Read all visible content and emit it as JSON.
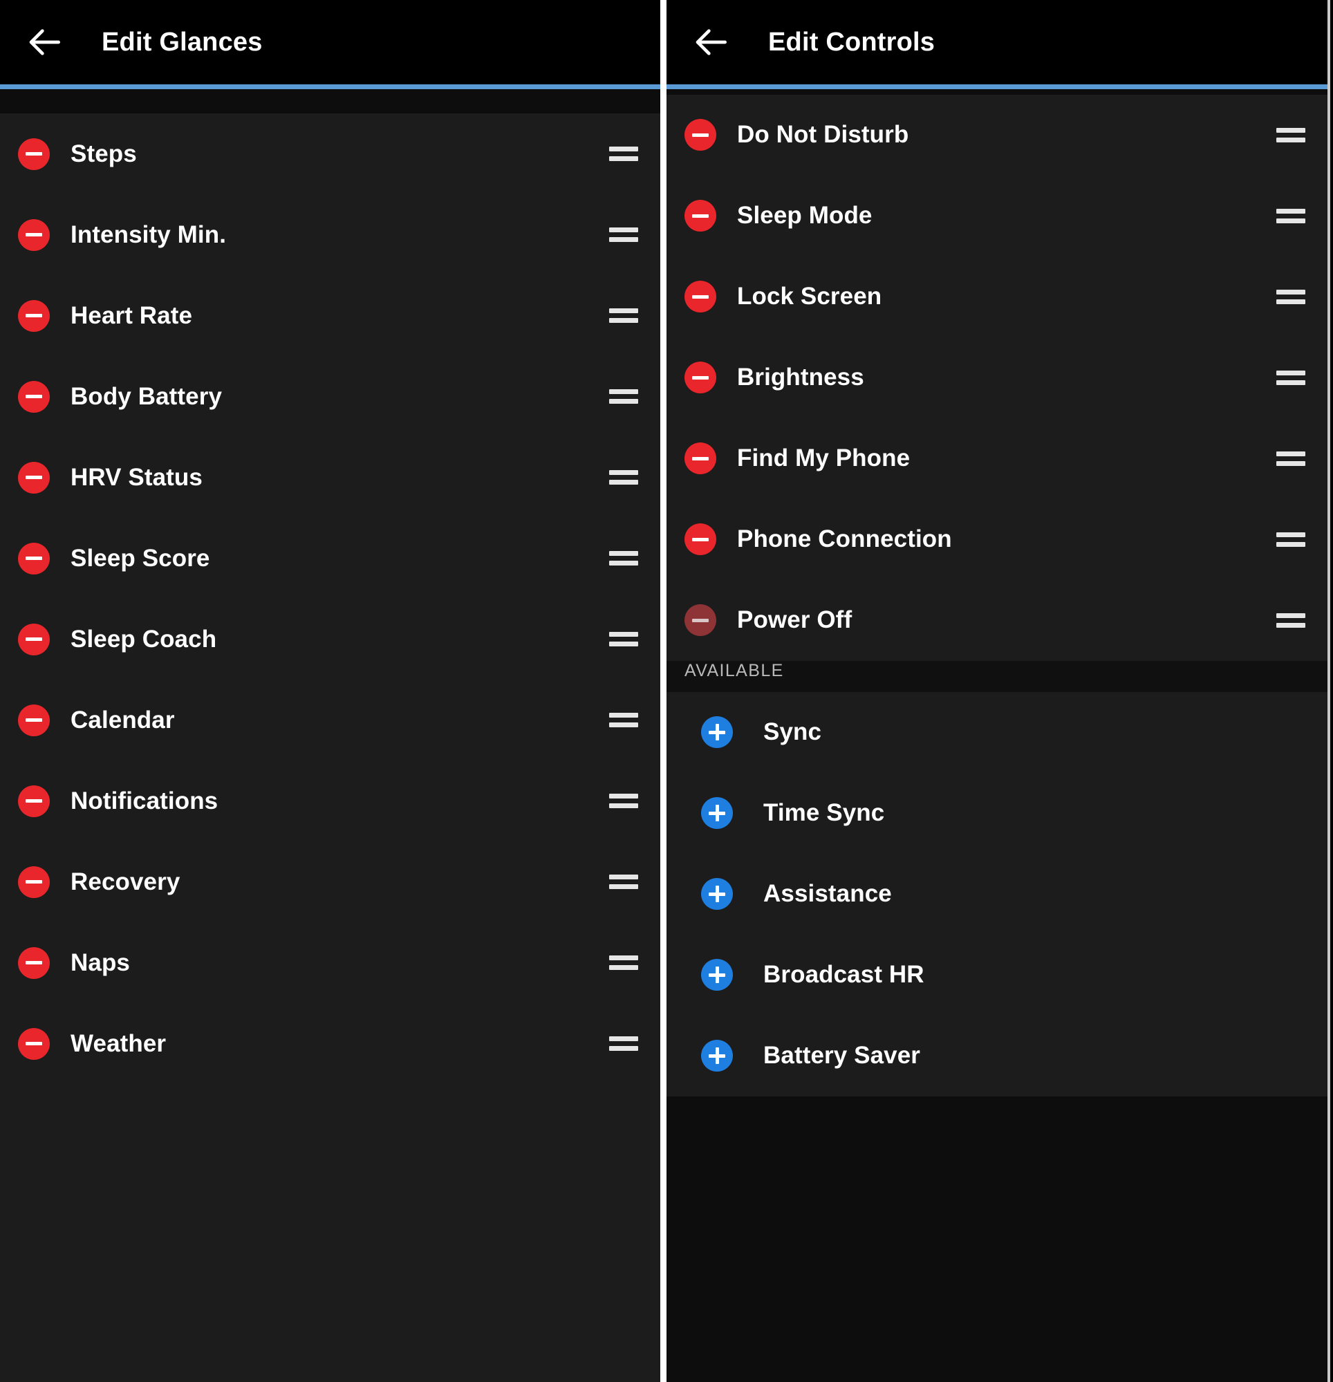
{
  "left_panel": {
    "appbar": {
      "back_icon": "arrow-left-icon",
      "title": "Edit Glances"
    },
    "active_items": [
      {
        "label": "Steps",
        "action_icon": "minus-icon",
        "drag_icon": "drag-handle-icon"
      },
      {
        "label": "Intensity Min.",
        "action_icon": "minus-icon",
        "drag_icon": "drag-handle-icon"
      },
      {
        "label": "Heart Rate",
        "action_icon": "minus-icon",
        "drag_icon": "drag-handle-icon"
      },
      {
        "label": "Body Battery",
        "action_icon": "minus-icon",
        "drag_icon": "drag-handle-icon"
      },
      {
        "label": "HRV Status",
        "action_icon": "minus-icon",
        "drag_icon": "drag-handle-icon"
      },
      {
        "label": "Sleep Score",
        "action_icon": "minus-icon",
        "drag_icon": "drag-handle-icon"
      },
      {
        "label": "Sleep Coach",
        "action_icon": "minus-icon",
        "drag_icon": "drag-handle-icon"
      },
      {
        "label": "Calendar",
        "action_icon": "minus-icon",
        "drag_icon": "drag-handle-icon"
      },
      {
        "label": "Notifications",
        "action_icon": "minus-icon",
        "drag_icon": "drag-handle-icon"
      },
      {
        "label": "Recovery",
        "action_icon": "minus-icon",
        "drag_icon": "drag-handle-icon"
      },
      {
        "label": "Naps",
        "action_icon": "minus-icon",
        "drag_icon": "drag-handle-icon"
      },
      {
        "label": "Weather",
        "action_icon": "minus-icon",
        "drag_icon": "drag-handle-icon"
      }
    ]
  },
  "right_panel": {
    "appbar": {
      "back_icon": "arrow-left-icon",
      "title": "Edit Controls"
    },
    "active_items": [
      {
        "label": "Do Not Disturb",
        "action_icon": "minus-icon",
        "drag_icon": "drag-handle-icon",
        "dimmed": false
      },
      {
        "label": "Sleep Mode",
        "action_icon": "minus-icon",
        "drag_icon": "drag-handle-icon",
        "dimmed": false
      },
      {
        "label": "Lock Screen",
        "action_icon": "minus-icon",
        "drag_icon": "drag-handle-icon",
        "dimmed": false
      },
      {
        "label": "Brightness",
        "action_icon": "minus-icon",
        "drag_icon": "drag-handle-icon",
        "dimmed": false
      },
      {
        "label": "Find My Phone",
        "action_icon": "minus-icon",
        "drag_icon": "drag-handle-icon",
        "dimmed": false
      },
      {
        "label": "Phone Connection",
        "action_icon": "minus-icon",
        "drag_icon": "drag-handle-icon",
        "dimmed": false
      },
      {
        "label": "Power Off",
        "action_icon": "minus-icon",
        "drag_icon": "drag-handle-icon",
        "dimmed": true
      }
    ],
    "available_section": {
      "header": "AVAILABLE",
      "items": [
        {
          "label": "Sync",
          "action_icon": "plus-icon"
        },
        {
          "label": "Time Sync",
          "action_icon": "plus-icon"
        },
        {
          "label": "Assistance",
          "action_icon": "plus-icon"
        },
        {
          "label": "Broadcast HR",
          "action_icon": "plus-icon"
        },
        {
          "label": "Battery Saver",
          "action_icon": "plus-icon"
        }
      ]
    }
  },
  "colors": {
    "accent_blue": "#5b9bd5",
    "remove_red": "#e8262b",
    "remove_red_dim": "#8e3436",
    "add_blue": "#1e7fe0",
    "appbar_bg": "#000000",
    "list_bg": "#1c1c1c",
    "section_bg": "#101010"
  }
}
